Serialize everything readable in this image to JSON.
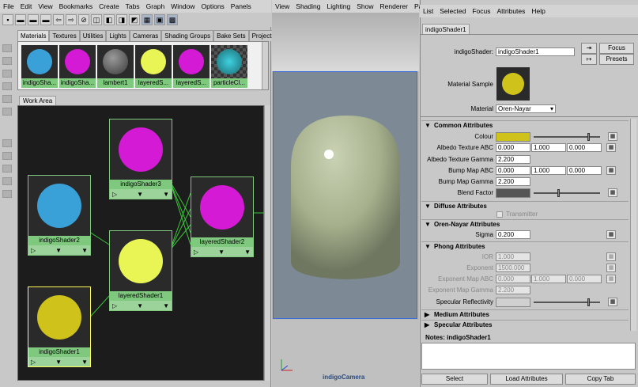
{
  "hypershade": {
    "menu": [
      "File",
      "Edit",
      "View",
      "Bookmarks",
      "Create",
      "Tabs",
      "Graph",
      "Window",
      "Options",
      "Panels"
    ],
    "tabs": [
      "Materials",
      "Textures",
      "Utilities",
      "Lights",
      "Cameras",
      "Shading Groups",
      "Bake Sets",
      "Projects"
    ],
    "swatches": [
      {
        "label": "indigoSha...",
        "color": "#3aa0d8"
      },
      {
        "label": "indigoSha...",
        "color": "#d41ad4"
      },
      {
        "label": "lambert1",
        "color": "#555555"
      },
      {
        "label": "layeredS...",
        "color": "#e8f555"
      },
      {
        "label": "layeredS...",
        "color": "#d41ad4"
      },
      {
        "label": "particleCl...",
        "color": "#2fa5b0"
      }
    ],
    "work_area_tab": "Work Area",
    "nodes": [
      {
        "label": "indigoShader3",
        "color": "#d41ad4"
      },
      {
        "label": "indigoShader2",
        "color": "#3aa0d8"
      },
      {
        "label": "layeredShader2",
        "color": "#d41ad4"
      },
      {
        "label": "layeredShader1",
        "color": "#e8f555"
      },
      {
        "label": "indigoShader1",
        "color": "#cfc21a"
      }
    ]
  },
  "viewport": {
    "menu": [
      "View",
      "Shading",
      "Lighting",
      "Show",
      "Renderer",
      "Panels"
    ],
    "camera_label": "indigoCamera"
  },
  "attr_editor": {
    "menu": [
      "List",
      "Selected",
      "Focus",
      "Attributes",
      "Help"
    ],
    "tab": "indigoShader1",
    "shader_label": "indigoShader:",
    "shader_value": "indigoShader1",
    "focus_btn": "Focus",
    "presets_btn": "Presets",
    "sample_label": "Material Sample",
    "material_label": "Material",
    "material_value": "Oren-Nayar",
    "sections": {
      "common": "Common Attributes",
      "diffuse": "Diffuse Attributes",
      "oren": "Oren-Nayar Attributes",
      "phong": "Phong Attributes",
      "medium": "Medium Attributes",
      "specular": "Specular Attributes"
    },
    "colour_label": "Colour",
    "albedo_abc_label": "Albedo Texture ABC",
    "albedo_abc": [
      "0.000",
      "1.000",
      "0.000"
    ],
    "albedo_gamma_label": "Albedo Texture Gamma",
    "albedo_gamma": "2.200",
    "bump_abc_label": "Bump Map ABC",
    "bump_abc": [
      "0.000",
      "1.000",
      "0.000"
    ],
    "bump_gamma_label": "Bump Map Gamma",
    "bump_gamma": "2.200",
    "blend_label": "Blend Factor",
    "transmitter_label": "Transmitter",
    "sigma_label": "Sigma",
    "sigma": "0.200",
    "ior_label": "IOR",
    "ior": "1.000",
    "exponent_label": "Exponent",
    "exponent": "1500.000",
    "exp_abc_label": "Exponent Map ABC",
    "exp_abc": [
      "0.000",
      "1.000",
      "0.000"
    ],
    "exp_gamma_label": "Exponent Map Gamma",
    "exp_gamma": "2.200",
    "spec_refl_label": "Specular Reflectivity",
    "notes_label": "Notes:",
    "notes_value": "indigoShader1",
    "buttons": {
      "select": "Select",
      "load": "Load Attributes",
      "copy": "Copy Tab"
    },
    "colors": {
      "colour": "#cfc21a",
      "blend": "#555555",
      "spec": "#d0d0d0"
    }
  }
}
